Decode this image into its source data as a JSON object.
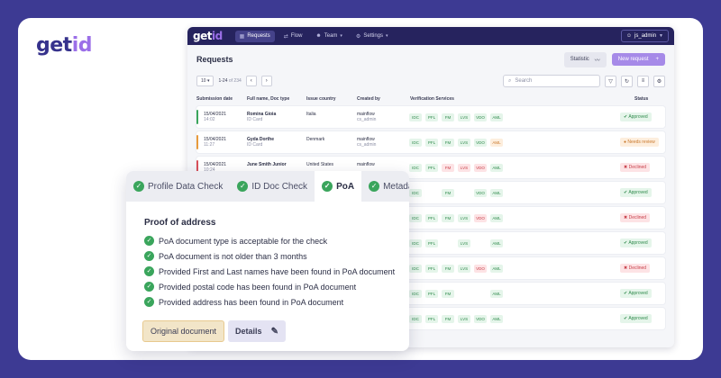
{
  "brand": {
    "name_a": "get",
    "name_b": "id"
  },
  "topbar": {
    "logo_a": "get",
    "logo_b": "id",
    "nav": [
      {
        "label": "Requests",
        "icon": "grid-icon",
        "glyph": "▦",
        "active": true,
        "caret": false
      },
      {
        "label": "Flow",
        "icon": "flow-icon",
        "glyph": "⇄",
        "active": false,
        "caret": false
      },
      {
        "label": "Team",
        "icon": "team-icon",
        "glyph": "☻",
        "active": false,
        "caret": true
      },
      {
        "label": "Settings",
        "icon": "gear-icon",
        "glyph": "⚙",
        "active": false,
        "caret": true
      }
    ],
    "user": "js_admin"
  },
  "page": {
    "title": "Requests",
    "statistic_label": "Statistic",
    "new_request_label": "New request"
  },
  "toolbar": {
    "page_size": "10",
    "range": "1-24",
    "total": "of 234",
    "search_placeholder": "Search"
  },
  "table": {
    "headers": [
      "Submission date",
      "Full name, Doc type",
      "Issue country",
      "Created by",
      "Verification Services",
      "Status"
    ],
    "rows": [
      {
        "date": "15/04/2021",
        "time": "14:02",
        "name": "Romina Gioia",
        "doc": "ID Card",
        "country": "Italia",
        "flow": "mainflow",
        "by": "cs_admin",
        "services": [
          [
            "IDC",
            "ok"
          ],
          [
            "PFL",
            "ok"
          ],
          [
            "FM",
            "ok"
          ],
          [
            "LVS",
            "ok"
          ],
          [
            "VDO",
            "ok"
          ],
          [
            "AML",
            "ok"
          ]
        ],
        "status": "Approved",
        "status_type": "approved",
        "stripe": "#3aa55c"
      },
      {
        "date": "15/04/2021",
        "time": "11:27",
        "name": "Gyda Dorthe",
        "doc": "ID Card",
        "country": "Denmark",
        "flow": "mainflow",
        "by": "cs_admin",
        "services": [
          [
            "IDC",
            "ok"
          ],
          [
            "PFL",
            "ok"
          ],
          [
            "FM",
            "ok"
          ],
          [
            "LVS",
            "ok"
          ],
          [
            "VDO",
            "ok"
          ],
          [
            "AML",
            "warn"
          ]
        ],
        "status": "Needs review",
        "status_type": "review",
        "stripe": "#e89a3c"
      },
      {
        "date": "15/04/2021",
        "time": "10:24",
        "name": "June Smith Junior",
        "doc": "",
        "country": "United States",
        "flow": "mainflow",
        "by": "",
        "services": [
          [
            "IDC",
            "ok"
          ],
          [
            "PFL",
            "ok"
          ],
          [
            "FM",
            "bad"
          ],
          [
            "LVS",
            "bad"
          ],
          [
            "VDO",
            "bad"
          ],
          [
            "AML",
            "ok"
          ]
        ],
        "status": "Declined",
        "status_type": "declined",
        "stripe": "#d9505a"
      },
      {
        "date": "",
        "time": "",
        "name": "",
        "doc": "",
        "country": "",
        "flow": "",
        "by": "",
        "services": [
          [
            "IDC",
            "ok"
          ],
          [
            "FM",
            "ok"
          ],
          [
            "VDO",
            "ok"
          ],
          [
            "AML",
            "ok"
          ]
        ],
        "status": "Approved",
        "status_type": "approved",
        "stripe": ""
      },
      {
        "date": "",
        "time": "",
        "name": "",
        "doc": "",
        "country": "",
        "flow": "",
        "by": "",
        "services": [
          [
            "IDC",
            "ok"
          ],
          [
            "PFL",
            "ok"
          ],
          [
            "FM",
            "ok"
          ],
          [
            "LVS",
            "ok"
          ],
          [
            "VDO",
            "bad"
          ],
          [
            "AML",
            "ok"
          ]
        ],
        "status": "Declined",
        "status_type": "declined",
        "stripe": ""
      },
      {
        "date": "",
        "time": "",
        "name": "",
        "doc": "",
        "country": "",
        "flow": "",
        "by": "",
        "services": [
          [
            "IDC",
            "ok"
          ],
          [
            "PFL",
            "ok"
          ],
          [
            "LVS",
            "ok"
          ],
          [
            "AML",
            "ok"
          ]
        ],
        "status": "Approved",
        "status_type": "approved",
        "stripe": ""
      },
      {
        "date": "",
        "time": "",
        "name": "",
        "doc": "",
        "country": "",
        "flow": "",
        "by": "",
        "services": [
          [
            "IDC",
            "ok"
          ],
          [
            "PFL",
            "ok"
          ],
          [
            "FM",
            "ok"
          ],
          [
            "LVS",
            "ok"
          ],
          [
            "VDO",
            "bad"
          ],
          [
            "AML",
            "ok"
          ]
        ],
        "status": "Declined",
        "status_type": "declined",
        "stripe": ""
      },
      {
        "date": "",
        "time": "",
        "name": "",
        "doc": "",
        "country": "",
        "flow": "",
        "by": "",
        "services": [
          [
            "IDC",
            "ok"
          ],
          [
            "PFL",
            "ok"
          ],
          [
            "FM",
            "ok"
          ],
          [
            "AML",
            "ok"
          ]
        ],
        "status": "Approved",
        "status_type": "approved",
        "stripe": ""
      },
      {
        "date": "",
        "time": "",
        "name": "",
        "doc": "",
        "country": "",
        "flow": "",
        "by": "",
        "services": [
          [
            "IDC",
            "ok"
          ],
          [
            "PFL",
            "ok"
          ],
          [
            "FM",
            "ok"
          ],
          [
            "LVS",
            "ok"
          ],
          [
            "VDO",
            "ok"
          ],
          [
            "AML",
            "ok"
          ]
        ],
        "status": "Approved",
        "status_type": "approved",
        "stripe": ""
      }
    ]
  },
  "panel": {
    "tabs": [
      {
        "label": "Profile Data Check",
        "active": false
      },
      {
        "label": "ID Doc Check",
        "active": false
      },
      {
        "label": "PoA",
        "active": true
      },
      {
        "label": "Metadata",
        "active": false
      }
    ],
    "title": "Proof of address",
    "checks": [
      "PoA document type is acceptable for the check",
      "PoA document is not older than 3 months",
      "Provided First and Last names have been found in PoA document",
      "Provided postal code has been found in PoA document",
      "Provided address has been found in PoA document"
    ],
    "original_doc_label": "Original document",
    "details_label": "Details"
  }
}
